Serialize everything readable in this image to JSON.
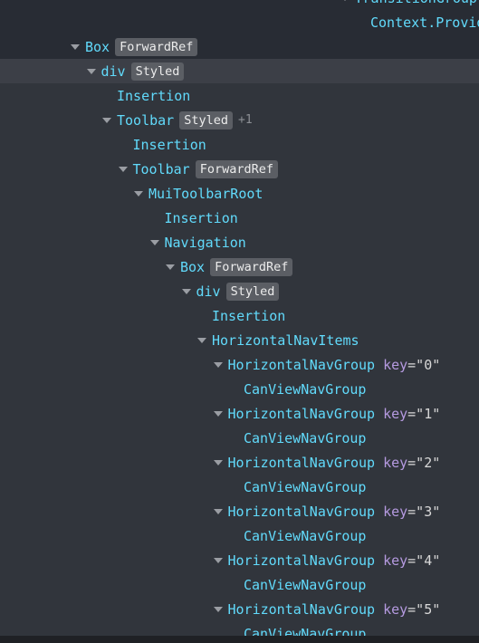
{
  "colors": {
    "component_name": "#61dafb",
    "key_name": "#b59ae0",
    "badge_bg": "#5b5e64",
    "selected_row": "#3c3f47"
  },
  "tree": {
    "selected_index": 3,
    "rows": [
      {
        "depth": 17,
        "name": "TransitionGroup",
        "expanded": true
      },
      {
        "depth": 18,
        "name": "Context.Provider"
      },
      {
        "depth": 0,
        "name": "Box",
        "badge": "ForwardRef",
        "expanded": true
      },
      {
        "depth": 1,
        "name": "div",
        "badge": "Styled",
        "expanded": true
      },
      {
        "depth": 2,
        "name": "Insertion"
      },
      {
        "depth": 2,
        "name": "Toolbar",
        "badge": "Styled",
        "extra": "+1",
        "expanded": true
      },
      {
        "depth": 3,
        "name": "Insertion"
      },
      {
        "depth": 3,
        "name": "Toolbar",
        "badge": "ForwardRef",
        "expanded": true
      },
      {
        "depth": 4,
        "name": "MuiToolbarRoot",
        "expanded": true
      },
      {
        "depth": 5,
        "name": "Insertion"
      },
      {
        "depth": 5,
        "name": "Navigation",
        "expanded": true
      },
      {
        "depth": 6,
        "name": "Box",
        "badge": "ForwardRef",
        "expanded": true
      },
      {
        "depth": 7,
        "name": "div",
        "badge": "Styled",
        "expanded": true
      },
      {
        "depth": 8,
        "name": "Insertion"
      },
      {
        "depth": 8,
        "name": "HorizontalNavItems",
        "expanded": true
      },
      {
        "depth": 9,
        "name": "HorizontalNavGroup",
        "key_label": "key",
        "key_value": "=\"0\"",
        "expanded": true
      },
      {
        "depth": 10,
        "name": "CanViewNavGroup"
      },
      {
        "depth": 9,
        "name": "HorizontalNavGroup",
        "key_label": "key",
        "key_value": "=\"1\"",
        "expanded": true
      },
      {
        "depth": 10,
        "name": "CanViewNavGroup"
      },
      {
        "depth": 9,
        "name": "HorizontalNavGroup",
        "key_label": "key",
        "key_value": "=\"2\"",
        "expanded": true
      },
      {
        "depth": 10,
        "name": "CanViewNavGroup"
      },
      {
        "depth": 9,
        "name": "HorizontalNavGroup",
        "key_label": "key",
        "key_value": "=\"3\"",
        "expanded": true
      },
      {
        "depth": 10,
        "name": "CanViewNavGroup"
      },
      {
        "depth": 9,
        "name": "HorizontalNavGroup",
        "key_label": "key",
        "key_value": "=\"4\"",
        "expanded": true
      },
      {
        "depth": 10,
        "name": "CanViewNavGroup"
      },
      {
        "depth": 9,
        "name": "HorizontalNavGroup",
        "key_label": "key",
        "key_value": "=\"5\"",
        "expanded": true
      },
      {
        "depth": 10,
        "name": "CanViewNavGroup"
      }
    ]
  }
}
